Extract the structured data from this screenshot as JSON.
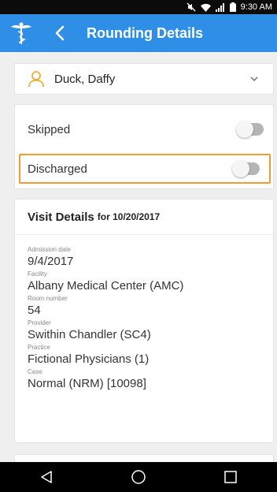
{
  "status_bar": {
    "time": "9:30 AM",
    "icons": [
      "mute-icon",
      "wifi-icon",
      "signal-icon",
      "battery-icon"
    ]
  },
  "app_bar": {
    "title": "Rounding Details",
    "background": "#2f8fe6",
    "icons": [
      "caduceus-logo-icon",
      "back-arrow-icon"
    ]
  },
  "patient": {
    "name": "Duck, Daffy",
    "icon": "person-icon",
    "dropdown_icon": "chevron-down-icon",
    "accent": "#f5a623"
  },
  "toggles": [
    {
      "label": "Skipped",
      "on": false
    },
    {
      "label": "Discharged",
      "on": false,
      "highlighted": true,
      "highlight_color": "#f39a38"
    }
  ],
  "visit": {
    "title": "Visit Details",
    "date_text": "for 10/20/2017",
    "fields": [
      {
        "label": "Admission date",
        "value": "9/4/2017"
      },
      {
        "label": "Facility",
        "value": "Albany Medical Center (AMC)"
      },
      {
        "label": "Room number",
        "value": "54"
      },
      {
        "label": "Provider",
        "value": "Swithin Chandler (SC4)"
      },
      {
        "label": "Practice",
        "value": "Fictional Physicians (1)"
      },
      {
        "label": "Case",
        "value": "Normal (NRM) [10098]"
      }
    ]
  },
  "nav_bar": {
    "buttons": [
      "back-triangle-icon",
      "home-circle-icon",
      "recents-square-icon"
    ]
  }
}
